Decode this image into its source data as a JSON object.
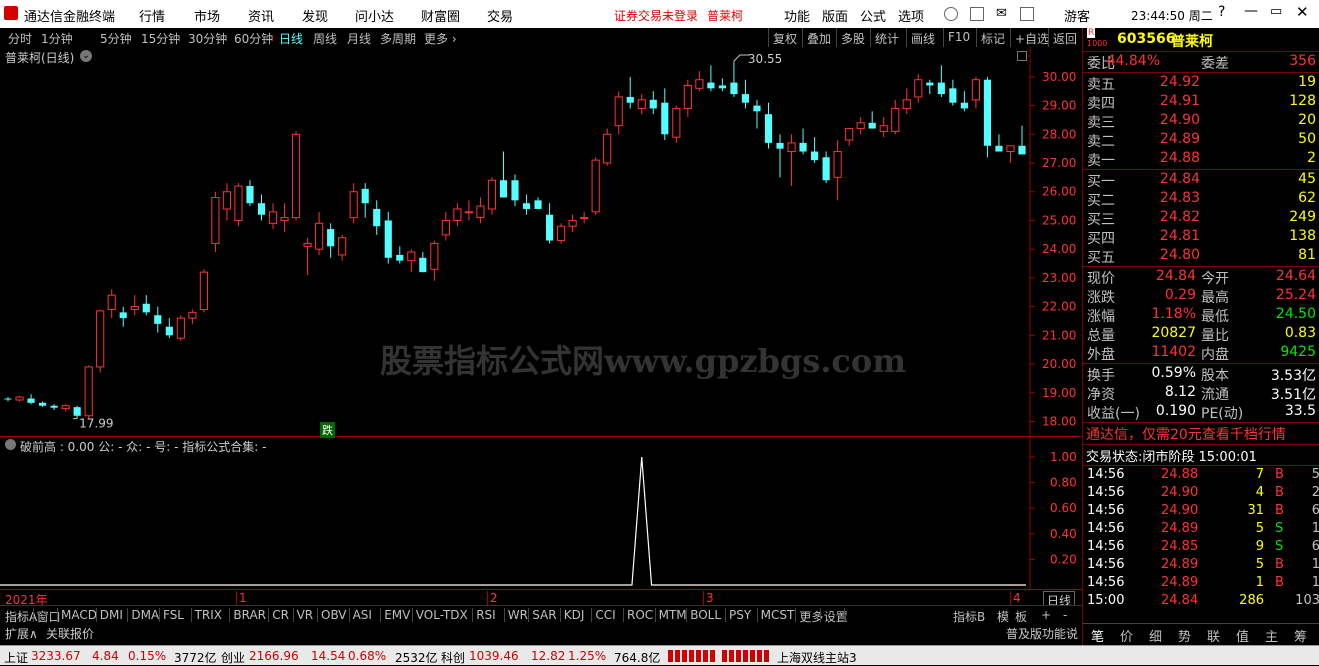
{
  "titlebar": {
    "app": "通达信金融终端",
    "menus": [
      "行情",
      "市场",
      "资讯",
      "发现",
      "问小达",
      "财富圈",
      "交易"
    ],
    "notice": "证券交易未登录",
    "stock": "普莱柯",
    "menus_right": [
      "功能",
      "版面",
      "公式",
      "选项"
    ],
    "user": "游客",
    "clock": "23:44:50 周二"
  },
  "periods": [
    "分时",
    "1分钟",
    "5分钟",
    "15分钟",
    "30分钟",
    "60分钟",
    "日线",
    "周线",
    "月线",
    "多周期",
    "更多 ›"
  ],
  "toolbar_right": [
    "复权",
    "叠加",
    "多股",
    "统计",
    "画线",
    "F10",
    "标记",
    "+自选",
    "返回"
  ],
  "chart": {
    "title": "普莱柯(日线)",
    "high_label": "30.55",
    "low_label": "17.99",
    "price_axis": [
      "30.00",
      "29.00",
      "28.00",
      "27.00",
      "26.00",
      "25.00",
      "24.00",
      "23.00",
      "22.00",
      "21.00",
      "20.00",
      "19.00",
      "18.00"
    ],
    "marker": "跌",
    "watermark": "股票指标公式网www.gpzbgs.com"
  },
  "indicator": {
    "header": "破前高 : 0.00  公: -  众: -  号: -  指标公式合集: -",
    "axis": [
      "1.00",
      "0.80",
      "0.60",
      "0.40",
      "0.20"
    ]
  },
  "time_axis": [
    "2021年",
    "1",
    "2",
    "3",
    "4"
  ],
  "period_box": "日线",
  "ind_tabs": [
    "指标A",
    "窗口",
    "MACD",
    "DMI",
    "DMA",
    "FSL",
    "TRIX",
    "BRAR",
    "CR",
    "VR",
    "OBV",
    "ASI",
    "EMV",
    "VOL-TDX",
    "RSI",
    "WR",
    "SAR",
    "KDJ",
    "CCI",
    "ROC",
    "MTM",
    "BOLL",
    "PSY",
    "MCST",
    "更多",
    "设置"
  ],
  "ind_tabs_right": [
    "指标B",
    "模",
    "板",
    "+",
    "-"
  ],
  "expand": [
    "扩展∧",
    "关联报价"
  ],
  "status": {
    "sh_name": "上证",
    "sh_val": "3233.67",
    "sh_chg": "4.84",
    "sh_pct": "0.15%",
    "sh_amt": "3772亿",
    "cy_name": "创业",
    "cy_val": "2166.96",
    "cy_chg": "14.54",
    "cy_pct": "0.68%",
    "cy_amt": "2532亿",
    "kc_name": "科创",
    "kc_val": "1039.46",
    "kc_chg": "12.82",
    "kc_pct": "1.25%",
    "kc_amt": "764.8亿",
    "server": "上海双线主站3"
  },
  "quote": {
    "code": "603566",
    "name": "普莱柯",
    "rlabel": "R",
    "webi_label": "委比",
    "webi": "44.84%",
    "weicha_label": "委差",
    "weicha": "356",
    "asks": [
      {
        "l": "卖五",
        "p": "24.92",
        "v": "19"
      },
      {
        "l": "卖四",
        "p": "24.91",
        "v": "128"
      },
      {
        "l": "卖三",
        "p": "24.90",
        "v": "20"
      },
      {
        "l": "卖二",
        "p": "24.89",
        "v": "50"
      },
      {
        "l": "卖一",
        "p": "24.88",
        "v": "2"
      }
    ],
    "bids": [
      {
        "l": "买一",
        "p": "24.84",
        "v": "45"
      },
      {
        "l": "买二",
        "p": "24.83",
        "v": "62"
      },
      {
        "l": "买三",
        "p": "24.82",
        "v": "249"
      },
      {
        "l": "买四",
        "p": "24.81",
        "v": "138"
      },
      {
        "l": "买五",
        "p": "24.80",
        "v": "81"
      }
    ],
    "stats1": [
      [
        "现价",
        "24.84",
        "今开",
        "24.64"
      ],
      [
        "涨跌",
        "0.29",
        "最高",
        "25.24"
      ],
      [
        "涨幅",
        "1.18%",
        "最低",
        "24.50"
      ],
      [
        "总量",
        "20827",
        "量比",
        "0.83"
      ],
      [
        "外盘",
        "11402",
        "内盘",
        "9425"
      ]
    ],
    "stats2": [
      [
        "换手",
        "0.59%",
        "股本",
        "3.53亿"
      ],
      [
        "净资",
        "8.12",
        "流通",
        "3.51亿"
      ],
      [
        "收益(一)",
        "0.190",
        "PE(动)",
        "33.5"
      ]
    ],
    "ad": "通达信，仅需20元查看千档行情",
    "trade_state": "交易状态:闭市阶段 15:00:01",
    "ticks": [
      [
        "14:56",
        "24.88",
        "7",
        "B",
        "5"
      ],
      [
        "14:56",
        "24.90",
        "4",
        "B",
        "2"
      ],
      [
        "14:56",
        "24.90",
        "31",
        "B",
        "6"
      ],
      [
        "14:56",
        "24.89",
        "5",
        "S",
        "1"
      ],
      [
        "14:56",
        "24.85",
        "9",
        "S",
        "6"
      ],
      [
        "14:56",
        "24.89",
        "5",
        "B",
        "1"
      ],
      [
        "14:56",
        "24.89",
        "1",
        "B",
        "1"
      ],
      [
        "15:00",
        "24.84",
        "286",
        "",
        "103"
      ]
    ],
    "bottom_tabs": [
      "笔",
      "价",
      "细",
      "势",
      "联",
      "值",
      "主",
      "筹"
    ],
    "footer": "普及版功能说明"
  },
  "chart_data": {
    "type": "candlestick",
    "ylim": [
      17.6,
      30.9
    ],
    "candles": [
      [
        18.8,
        18.85,
        18.7,
        18.78
      ],
      [
        18.75,
        18.9,
        18.7,
        18.85
      ],
      [
        18.8,
        18.95,
        18.6,
        18.65
      ],
      [
        18.65,
        18.7,
        18.5,
        18.55
      ],
      [
        18.55,
        18.6,
        18.4,
        18.48
      ],
      [
        18.45,
        18.6,
        18.35,
        18.55
      ],
      [
        18.5,
        18.55,
        18.1,
        18.2
      ],
      [
        18.2,
        19.95,
        18.1,
        19.9
      ],
      [
        19.9,
        21.9,
        19.7,
        21.85
      ],
      [
        21.9,
        22.6,
        21.6,
        22.4
      ],
      [
        21.8,
        22.0,
        21.3,
        21.6
      ],
      [
        21.9,
        22.4,
        21.7,
        22.0
      ],
      [
        22.1,
        22.4,
        21.7,
        21.8
      ],
      [
        21.7,
        22.0,
        21.1,
        21.4
      ],
      [
        21.3,
        21.6,
        20.9,
        21.0
      ],
      [
        20.9,
        21.7,
        20.8,
        21.6
      ],
      [
        21.6,
        21.9,
        21.4,
        21.8
      ],
      [
        21.9,
        23.3,
        21.8,
        23.2
      ],
      [
        24.2,
        26.0,
        23.9,
        25.8
      ],
      [
        25.4,
        26.3,
        25.0,
        26.0
      ],
      [
        25.0,
        26.3,
        24.8,
        26.2
      ],
      [
        26.2,
        26.4,
        25.5,
        25.6
      ],
      [
        25.6,
        25.9,
        25.0,
        25.2
      ],
      [
        24.9,
        25.6,
        24.7,
        25.3
      ],
      [
        25.0,
        25.6,
        24.6,
        25.1
      ],
      [
        25.1,
        28.1,
        25.0,
        28.0
      ],
      [
        24.1,
        24.4,
        23.1,
        24.2
      ],
      [
        24.0,
        25.3,
        23.8,
        24.9
      ],
      [
        24.7,
        24.9,
        23.7,
        24.1
      ],
      [
        23.8,
        24.5,
        23.6,
        24.4
      ],
      [
        25.1,
        26.3,
        24.9,
        26.0
      ],
      [
        26.1,
        26.3,
        25.1,
        25.6
      ],
      [
        25.4,
        25.7,
        24.5,
        24.8
      ],
      [
        25.0,
        25.3,
        23.5,
        23.7
      ],
      [
        23.8,
        24.1,
        23.5,
        23.6
      ],
      [
        23.6,
        24.0,
        23.2,
        23.9
      ],
      [
        23.7,
        23.9,
        23.2,
        23.2
      ],
      [
        23.3,
        24.3,
        22.9,
        24.2
      ],
      [
        24.5,
        25.3,
        24.3,
        25.0
      ],
      [
        25.0,
        25.6,
        24.8,
        25.4
      ],
      [
        25.3,
        25.7,
        25.0,
        25.3
      ],
      [
        25.1,
        25.8,
        24.9,
        25.5
      ],
      [
        25.4,
        26.5,
        25.2,
        26.4
      ],
      [
        26.4,
        27.4,
        26.0,
        25.8
      ],
      [
        26.4,
        26.6,
        25.5,
        25.7
      ],
      [
        25.6,
        25.9,
        25.2,
        25.4
      ],
      [
        25.7,
        25.8,
        25.4,
        25.4
      ],
      [
        25.2,
        25.6,
        24.2,
        24.3
      ],
      [
        24.3,
        24.9,
        24.2,
        24.8
      ],
      [
        24.8,
        25.2,
        24.6,
        25.0
      ],
      [
        25.1,
        25.3,
        24.9,
        25.1
      ],
      [
        25.3,
        27.2,
        25.2,
        27.1
      ],
      [
        27.0,
        28.2,
        26.9,
        28.0
      ],
      [
        28.3,
        29.5,
        28.0,
        29.3
      ],
      [
        29.3,
        30.0,
        28.9,
        29.1
      ],
      [
        28.9,
        29.4,
        28.7,
        29.2
      ],
      [
        29.2,
        29.5,
        28.7,
        28.9
      ],
      [
        29.1,
        29.6,
        27.8,
        28.0
      ],
      [
        27.9,
        29.0,
        27.7,
        28.9
      ],
      [
        28.9,
        29.9,
        28.6,
        29.7
      ],
      [
        29.6,
        30.2,
        29.5,
        29.9
      ],
      [
        29.8,
        30.4,
        29.5,
        29.6
      ],
      [
        29.7,
        29.95,
        29.5,
        29.6
      ],
      [
        29.8,
        30.55,
        29.3,
        29.4
      ],
      [
        29.4,
        29.9,
        28.9,
        29.1
      ],
      [
        29.0,
        29.2,
        28.2,
        28.8
      ],
      [
        28.7,
        29.1,
        27.5,
        27.7
      ],
      [
        27.7,
        28.0,
        26.5,
        27.5
      ],
      [
        27.4,
        28.0,
        26.2,
        27.7
      ],
      [
        27.7,
        28.2,
        27.3,
        27.4
      ],
      [
        27.4,
        27.9,
        27.0,
        27.1
      ],
      [
        27.2,
        27.4,
        26.3,
        26.4
      ],
      [
        26.5,
        27.8,
        25.7,
        27.4
      ],
      [
        27.8,
        28.2,
        27.6,
        28.2
      ],
      [
        28.2,
        28.6,
        28.0,
        28.4
      ],
      [
        28.4,
        28.8,
        28.2,
        28.2
      ],
      [
        28.1,
        28.6,
        27.9,
        28.3
      ],
      [
        28.1,
        29.2,
        28.0,
        28.9
      ],
      [
        28.9,
        29.6,
        28.7,
        29.2
      ],
      [
        29.3,
        30.1,
        29.1,
        29.9
      ],
      [
        29.8,
        29.9,
        29.4,
        29.7
      ],
      [
        29.8,
        30.4,
        29.3,
        29.4
      ],
      [
        29.6,
        29.9,
        29.0,
        29.1
      ],
      [
        29.1,
        29.5,
        28.8,
        28.9
      ],
      [
        29.2,
        30.0,
        28.9,
        29.9
      ],
      [
        29.9,
        30.0,
        27.2,
        27.6
      ],
      [
        27.6,
        28.0,
        27.4,
        27.4
      ],
      [
        27.4,
        27.6,
        27.0,
        27.6
      ],
      [
        27.6,
        28.3,
        27.3,
        27.3
      ]
    ],
    "indicator_values": [
      0,
      1,
      0
    ],
    "indicator_spike_index": 55
  }
}
